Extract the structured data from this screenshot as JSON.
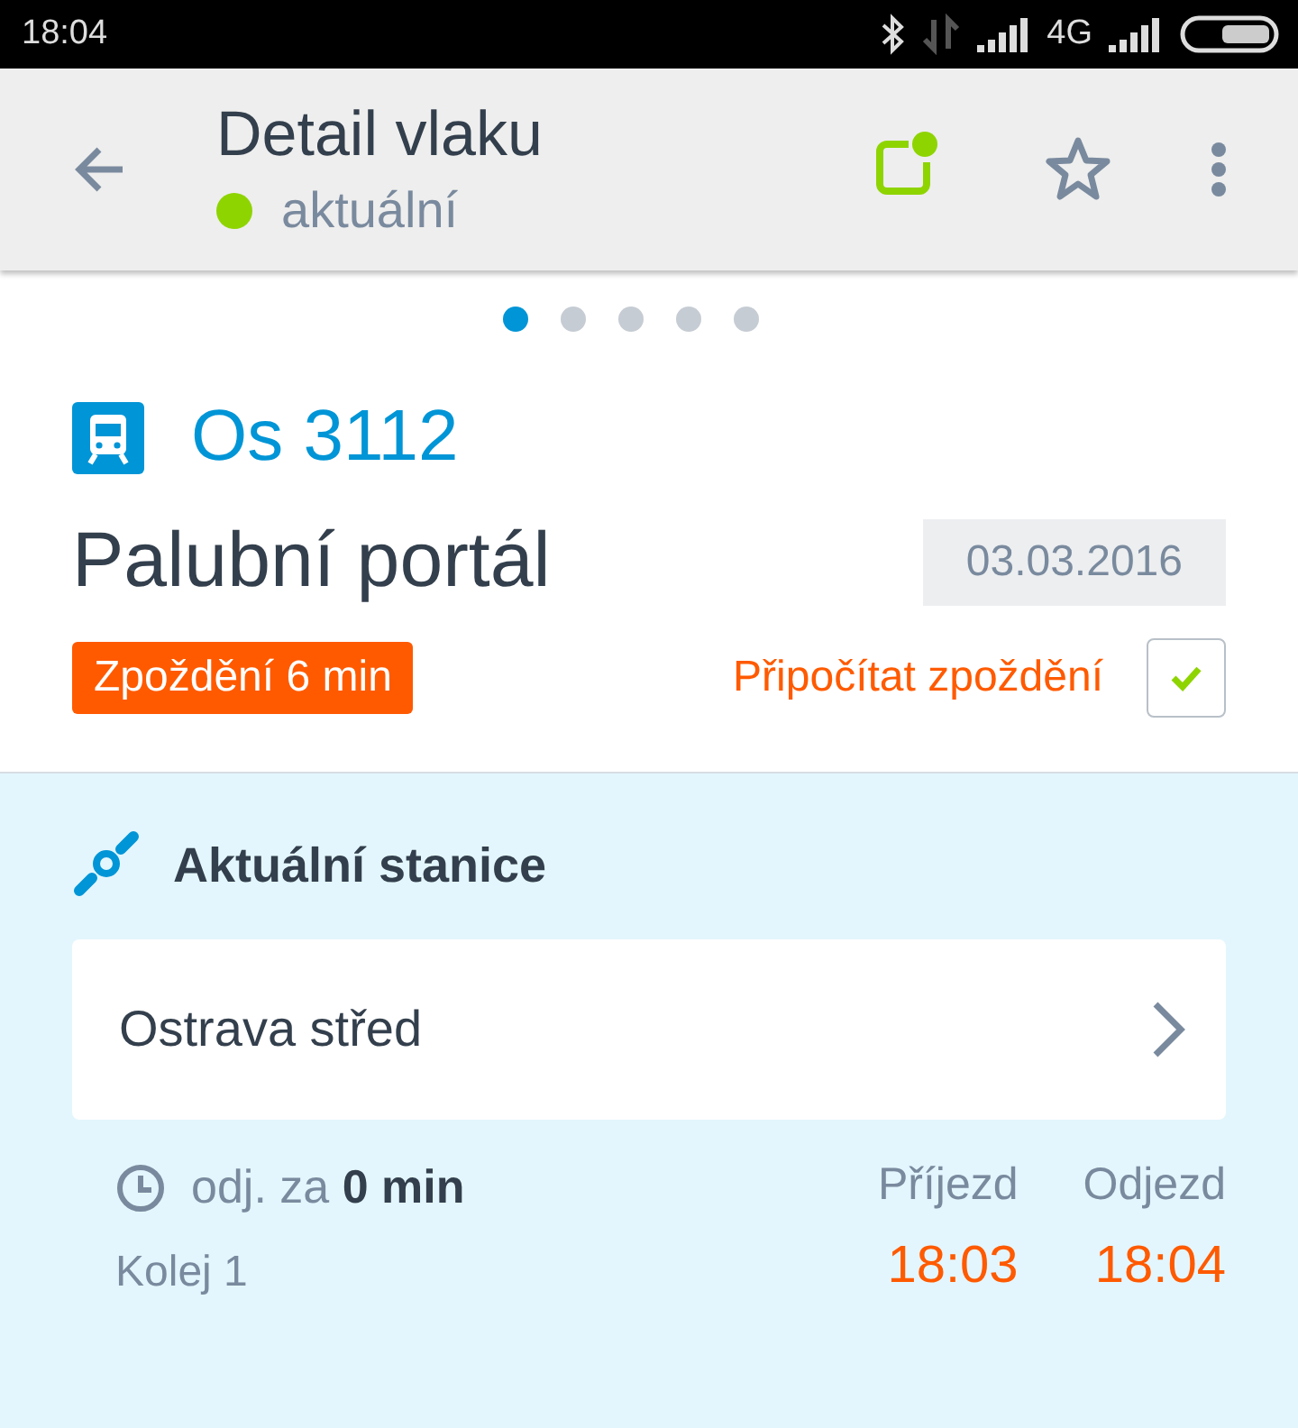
{
  "status_bar": {
    "time": "18:04",
    "network": "4G"
  },
  "toolbar": {
    "title": "Detail vlaku",
    "status": {
      "label": "aktuální",
      "color": "#8ed400"
    }
  },
  "pager": [
    {
      "selected": true
    },
    {
      "selected": false
    },
    {
      "selected": false
    },
    {
      "selected": false
    },
    {
      "selected": false
    }
  ],
  "train": {
    "number": "Os 3112",
    "name": "Palubní portál",
    "date": "03.03.2016",
    "delay": "Zpoždění 6 min",
    "add_delay": {
      "label": "Připočítat zpoždění",
      "checked": true
    }
  },
  "station": {
    "heading": "Aktuální stanice",
    "name": "Ostrava střed",
    "departure_in": "odj. za **0 min**",
    "track": "Kolej 1",
    "arrival_label": "Příjezd",
    "arrival": "18:03",
    "departure_label": "Odjezd",
    "departure": "18:04"
  }
}
